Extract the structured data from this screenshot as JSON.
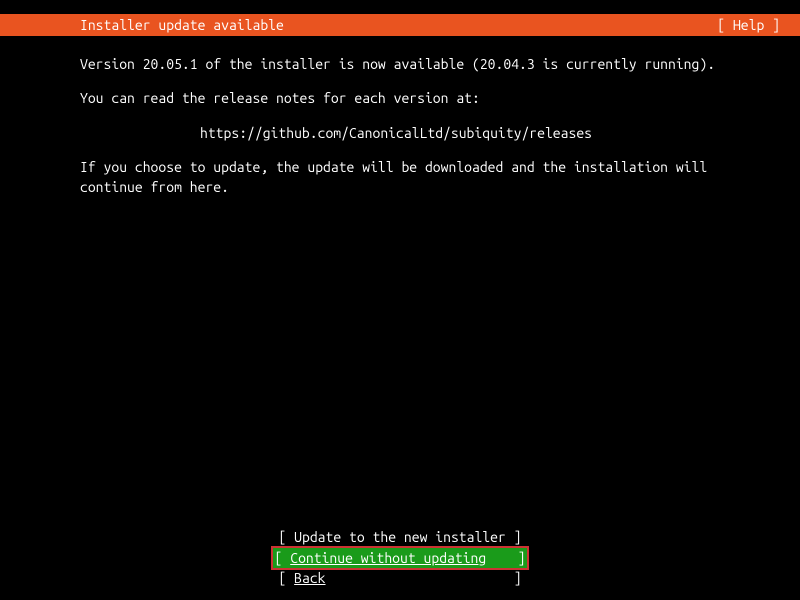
{
  "header": {
    "title": "Installer update available",
    "help": "[ Help ]"
  },
  "body": {
    "line1": "Version 20.05.1 of the installer is now available (20.04.3 is currently running).",
    "line2": "You can read the release notes for each version at:",
    "url": "https://github.com/CanonicalLtd/subiquity/releases",
    "line3": "If you choose to update, the update will be downloaded and the installation will continue from here."
  },
  "buttons": {
    "update": "[ Update to the new installer ]",
    "continue_open": "[ ",
    "continue_label": "Continue without updating",
    "continue_close": "    ]",
    "back_open": "[ ",
    "back_label": "Back",
    "back_close": "                        ]"
  }
}
